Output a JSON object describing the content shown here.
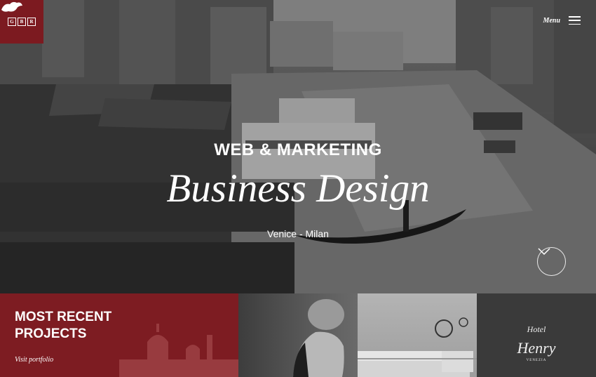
{
  "brand": {
    "logo_letters": [
      "G",
      "B",
      "R"
    ]
  },
  "header": {
    "menu_label": "Menu"
  },
  "hero": {
    "kicker": "WEB & MARKETING",
    "title": "Business Design",
    "subtitle": "Venice - Milan"
  },
  "projects": {
    "heading_line1": "MOST RECENT",
    "heading_line2": "PROJECTS",
    "link_label": "Visit portfolio"
  },
  "henry_tile": {
    "hotel": "Hotel",
    "name": "Henry",
    "city": "VENEZIA"
  },
  "colors": {
    "brand_red": "#7c1a20"
  },
  "icons": {
    "menu": "hamburger-icon",
    "scroll": "chevron-down-icon",
    "logo": "lion-icon"
  }
}
